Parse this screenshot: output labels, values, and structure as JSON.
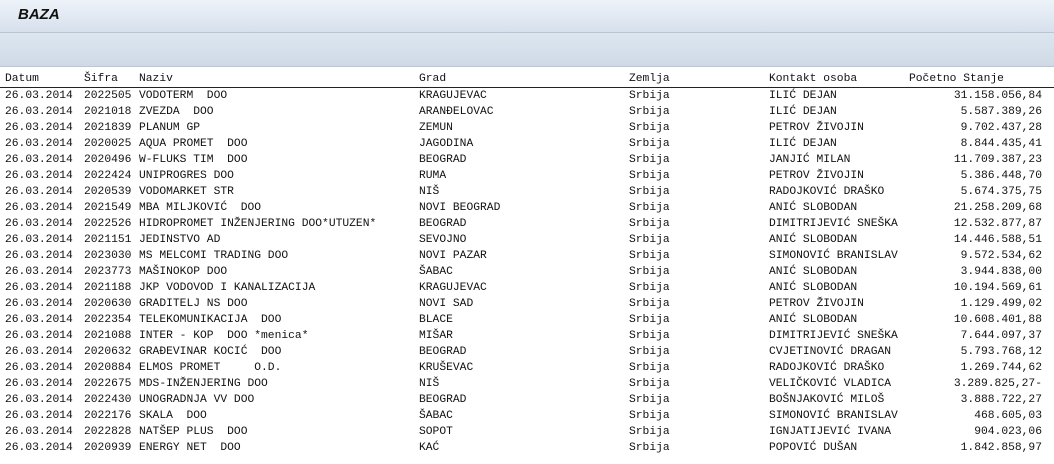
{
  "window": {
    "title": "BAZA"
  },
  "report": {
    "columns": {
      "date": "Datum",
      "code": "Šifra",
      "name": "Naziv",
      "city": "Grad",
      "country": "Zemlja",
      "contact": "Kontakt osoba",
      "balance": "Početno Stanje"
    },
    "rows": [
      {
        "date": "26.03.2014",
        "code": "2022505",
        "name": "VODOTERM  DOO",
        "city": "KRAGUJEVAC",
        "country": "Srbija",
        "contact": "ILIĆ DEJAN",
        "balance": "31.158.056,84"
      },
      {
        "date": "26.03.2014",
        "code": "2021018",
        "name": "ZVEZDA  DOO",
        "city": "ARANĐELOVAC",
        "country": "Srbija",
        "contact": "ILIĆ DEJAN",
        "balance": "5.587.389,26"
      },
      {
        "date": "26.03.2014",
        "code": "2021839",
        "name": "PLANUM GP",
        "city": "ZEMUN",
        "country": "Srbija",
        "contact": "PETROV ŽIVOJIN",
        "balance": "9.702.437,28"
      },
      {
        "date": "26.03.2014",
        "code": "2020025",
        "name": "AQUA PROMET  DOO",
        "city": "JAGODINA",
        "country": "Srbija",
        "contact": "ILIĆ DEJAN",
        "balance": "8.844.435,41"
      },
      {
        "date": "26.03.2014",
        "code": "2020496",
        "name": "W-FLUKS TIM  DOO",
        "city": "BEOGRAD",
        "country": "Srbija",
        "contact": "JANJIĆ MILAN",
        "balance": "11.709.387,23"
      },
      {
        "date": "26.03.2014",
        "code": "2022424",
        "name": "UNIPROGRES DOO",
        "city": "RUMA",
        "country": "Srbija",
        "contact": "PETROV ŽIVOJIN",
        "balance": "5.386.448,70"
      },
      {
        "date": "26.03.2014",
        "code": "2020539",
        "name": "VODOMARKET STR",
        "city": "NIŠ",
        "country": "Srbija",
        "contact": "RADOJKOVIĆ DRAŠKO",
        "balance": "5.674.375,75"
      },
      {
        "date": "26.03.2014",
        "code": "2021549",
        "name": "MBA MILJKOVIĆ  DOO",
        "city": "NOVI BEOGRAD",
        "country": "Srbija",
        "contact": "ANIĆ SLOBODAN",
        "balance": "21.258.209,68"
      },
      {
        "date": "26.03.2014",
        "code": "2022526",
        "name": "HIDROPROMET INŽENJERING DOO*UTUZEN*",
        "city": "BEOGRAD",
        "country": "Srbija",
        "contact": "DIMITRIJEVIĆ SNEŠKA",
        "balance": "12.532.877,87"
      },
      {
        "date": "26.03.2014",
        "code": "2021151",
        "name": "JEDINSTVO AD",
        "city": "SEVOJNO",
        "country": "Srbija",
        "contact": "ANIĆ SLOBODAN",
        "balance": "14.446.588,51"
      },
      {
        "date": "26.03.2014",
        "code": "2023030",
        "name": "MS MELCOMI TRADING DOO",
        "city": "NOVI PAZAR",
        "country": "Srbija",
        "contact": "SIMONOVIĆ BRANISLAV",
        "balance": "9.572.534,62"
      },
      {
        "date": "26.03.2014",
        "code": "2023773",
        "name": "MAŠINOKOP DOO",
        "city": "ŠABAC",
        "country": "Srbija",
        "contact": "ANIĆ SLOBODAN",
        "balance": "3.944.838,00"
      },
      {
        "date": "26.03.2014",
        "code": "2021188",
        "name": "JKP VODOVOD I KANALIZACIJA",
        "city": "KRAGUJEVAC",
        "country": "Srbija",
        "contact": "ANIĆ SLOBODAN",
        "balance": "10.194.569,61"
      },
      {
        "date": "26.03.2014",
        "code": "2020630",
        "name": "GRADITELJ NS DOO",
        "city": "NOVI SAD",
        "country": "Srbija",
        "contact": "PETROV ŽIVOJIN",
        "balance": "1.129.499,02"
      },
      {
        "date": "26.03.2014",
        "code": "2022354",
        "name": "TELEKOMUNIKACIJA  DOO",
        "city": "BLACE",
        "country": "Srbija",
        "contact": "ANIĆ SLOBODAN",
        "balance": "10.608.401,88"
      },
      {
        "date": "26.03.2014",
        "code": "2021088",
        "name": "INTER - KOP  DOO *menica*",
        "city": "MIŠAR",
        "country": "Srbija",
        "contact": "DIMITRIJEVIĆ SNEŠKA",
        "balance": "7.644.097,37"
      },
      {
        "date": "26.03.2014",
        "code": "2020632",
        "name": "GRAĐEVINAR KOCIĆ  DOO",
        "city": "BEOGRAD",
        "country": "Srbija",
        "contact": "CVJETINOVIĆ DRAGAN",
        "balance": "5.793.768,12"
      },
      {
        "date": "26.03.2014",
        "code": "2020884",
        "name": "ELMOS PROMET     O.D.",
        "city": "KRUŠEVAC",
        "country": "Srbija",
        "contact": "RADOJKOVIĆ DRAŠKO",
        "balance": "1.269.744,62"
      },
      {
        "date": "26.03.2014",
        "code": "2022675",
        "name": "MDS-INŽENJERING DOO",
        "city": "NIŠ",
        "country": "Srbija",
        "contact": "VELIČKOVIĆ VLADICA",
        "balance": "3.289.825,27-"
      },
      {
        "date": "26.03.2014",
        "code": "2022430",
        "name": "UNOGRADNJA VV DOO",
        "city": "BEOGRAD",
        "country": "Srbija",
        "contact": "BOŠNJAKOVIĆ MILOŠ",
        "balance": "3.888.722,27"
      },
      {
        "date": "26.03.2014",
        "code": "2022176",
        "name": "SKALA  DOO",
        "city": "ŠABAC",
        "country": "Srbija",
        "contact": "SIMONOVIĆ BRANISLAV",
        "balance": "468.605,03"
      },
      {
        "date": "26.03.2014",
        "code": "2022828",
        "name": "NATŠEP PLUS  DOO",
        "city": "SOPOT",
        "country": "Srbija",
        "contact": "IGNJATIJEVIĆ IVANA",
        "balance": "904.023,06"
      },
      {
        "date": "26.03.2014",
        "code": "2020939",
        "name": "ENERGY NET  DOO",
        "city": "KAĆ",
        "country": "Srbija",
        "contact": "POPOVIĆ DUŠAN",
        "balance": "1.842.858,97"
      }
    ]
  }
}
